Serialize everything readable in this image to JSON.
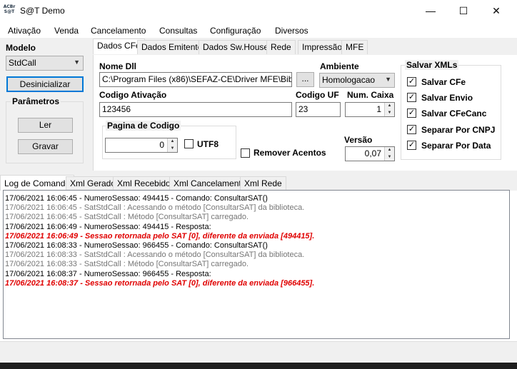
{
  "window": {
    "title": "S@T Demo",
    "icon_text": "ACBr S@T",
    "minimize_glyph": "—",
    "maximize_glyph": "☐",
    "close_glyph": "✕"
  },
  "menu": [
    "Ativação",
    "Venda",
    "Cancelamento",
    "Consultas",
    "Configuração",
    "Diversos"
  ],
  "left_panel": {
    "modelo_label": "Modelo",
    "modelo_value": "StdCall",
    "desinicializar_label": "Desinicializar",
    "parametros_title": "Parâmetros",
    "ler_label": "Ler",
    "gravar_label": "Gravar"
  },
  "config_tabs": [
    "Dados CFe",
    "Dados Emitente",
    "Dados Sw.House",
    "Rede",
    "Impressão",
    "MFE"
  ],
  "dados_cfe": {
    "nome_dll_label": "Nome Dll",
    "nome_dll_value": "C:\\Program Files (x86)\\SEFAZ-CE\\Driver MFE\\Bibliotec",
    "browse_label": "...",
    "ambiente_label": "Ambiente",
    "ambiente_value": "Homologacao",
    "codigo_ativacao_label": "Codigo Ativação",
    "codigo_ativacao_value": "123456",
    "codigo_uf_label": "Codigo UF",
    "codigo_uf_value": "23",
    "num_caixa_label": "Num. Caixa",
    "num_caixa_value": "1",
    "pagina_codigo_title": "Pagina de Codigo",
    "pagina_codigo_value": "0",
    "utf8_label": "UTF8",
    "remover_acentos_label": "Remover Acentos",
    "versao_label": "Versão",
    "versao_value": "0,07"
  },
  "salvar_xmls": {
    "title": "Salvar XMLs",
    "items": [
      {
        "label": "Salvar CFe",
        "checked": true
      },
      {
        "label": "Salvar Envio",
        "checked": true
      },
      {
        "label": "Salvar CFeCanc",
        "checked": true
      },
      {
        "label": "Separar Por CNPJ",
        "checked": true
      },
      {
        "label": "Separar Por Data",
        "checked": true
      }
    ]
  },
  "log_tabs": [
    "Log de Comando",
    "Xml Gerado",
    "Xml Recebido",
    "Xml Cancelamento",
    "Xml Rede"
  ],
  "log_lines": [
    {
      "text": "17/06/2021 16:06:45 - NumeroSessao: 494415 - Comando: ConsultarSAT()",
      "style": "black"
    },
    {
      "text": "17/06/2021 16:06:45 - SatStdCall : Acessando o método [ConsultarSAT] da biblioteca.",
      "style": "gray"
    },
    {
      "text": "17/06/2021 16:06:45 - SatStdCall : Método [ConsultarSAT] carregado.",
      "style": "gray"
    },
    {
      "text": "17/06/2021 16:06:49 - NumeroSessao: 494415 - Resposta:",
      "style": "black"
    },
    {
      "text": "17/06/2021 16:06:49 - Sessao retornada pelo SAT [0], diferente da enviada [494415].",
      "style": "red"
    },
    {
      "text": "17/06/2021 16:08:33 - NumeroSessao: 966455 - Comando: ConsultarSAT()",
      "style": "black"
    },
    {
      "text": "17/06/2021 16:08:33 - SatStdCall : Acessando o método [ConsultarSAT] da biblioteca.",
      "style": "gray"
    },
    {
      "text": "17/06/2021 16:08:33 - SatStdCall : Método [ConsultarSAT] carregado.",
      "style": "gray"
    },
    {
      "text": "17/06/2021 16:08:37 - NumeroSessao: 966455 - Resposta:",
      "style": "black"
    },
    {
      "text": "17/06/2021 16:08:37 - Sessao retornada pelo SAT [0], diferente da enviada [966455].",
      "style": "red"
    }
  ]
}
